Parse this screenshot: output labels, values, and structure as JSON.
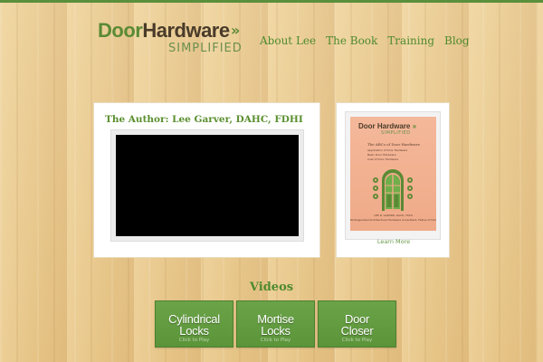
{
  "header": {
    "logo": {
      "part1": "Door",
      "part2": "Hardware",
      "chevron": "»",
      "sub": "SIMPLIFIED"
    },
    "nav": [
      "About Lee",
      "The Book",
      "Training",
      "Blog"
    ]
  },
  "author": {
    "title": "The Author: Lee Garver, DAHC, FDHI"
  },
  "book": {
    "cover": {
      "brand_part1": "Door",
      "brand_part2": "Hardware",
      "brand_chevron": "»",
      "brand_sub": "SIMPLIFIED",
      "heading": "The ABCs of Door Hardware",
      "list": [
        "Application of Door Hardware",
        "Basic Door Hardware",
        "Cost of Door Hardware"
      ],
      "author_line": "LEE R. GARVER, DAHC, FDHI",
      "author_sub": "Distinguished Architectural Hardware Consultant, Fellow of Door and Hardware Institute"
    },
    "learn_more": "Learn More"
  },
  "videos": {
    "heading": "Videos",
    "buttons": [
      {
        "label_line1": "Cylindrical",
        "label_line2": "Locks",
        "sub": "Click to Play"
      },
      {
        "label_line1": "Mortise",
        "label_line2": "Locks",
        "sub": "Click to Play"
      },
      {
        "label_line1": "Door",
        "label_line2": "Closer",
        "sub": "Click to Play"
      }
    ]
  },
  "colors": {
    "accent_green": "#5b8a35",
    "button_green": "#6ba349",
    "wood": "#e8c98e"
  }
}
